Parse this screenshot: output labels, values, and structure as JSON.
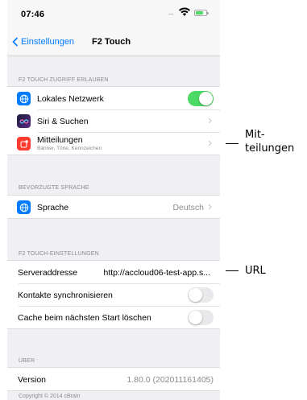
{
  "status": {
    "time": "07:46",
    "signal": "....",
    "wifi_icon": "wifi-icon",
    "battery_icon": "battery-charging-icon"
  },
  "nav": {
    "back_label": "Einstellungen",
    "title": "F2 Touch"
  },
  "sections": {
    "access": {
      "header": "F2 TOUCH ZUGRIFF ERLAUBEN",
      "local_network": {
        "label": "Lokales Netzwerk",
        "enabled": true,
        "icon": "globe-icon",
        "icon_color": "#007aff"
      },
      "siri": {
        "label": "Siri & Suchen",
        "icon": "siri-icon"
      },
      "notifications": {
        "label": "Mitteilungen",
        "sublabel": "Banner, Töne, Kennzeichen",
        "icon": "notification-icon",
        "icon_color": "#ff3b30"
      }
    },
    "language": {
      "header": "BEVORZUGTE SPRACHE",
      "language": {
        "label": "Sprache",
        "value": "Deutsch",
        "icon": "globe-icon",
        "icon_color": "#007aff"
      }
    },
    "settings": {
      "header": "F2 TOUCH-EINSTELLUNGEN",
      "server": {
        "label": "Serveraddresse",
        "value": "http://accloud06-test-app.s..."
      },
      "sync_contacts": {
        "label": "Kontakte synchronisieren",
        "enabled": false
      },
      "clear_cache": {
        "label": "Cache beim nächsten Start löschen",
        "enabled": false
      }
    },
    "about": {
      "header": "ÜBER",
      "version": {
        "label": "Version",
        "value": "1.80.0 (202011161405)"
      },
      "copyright": "Copyright © 2014 cBrain"
    }
  },
  "annotations": {
    "notifications_line1": "Mit-",
    "notifications_line2": "teilungen",
    "url": "URL"
  },
  "colors": {
    "accent": "#007aff",
    "toggle_on": "#4cd964",
    "background": "#efeff4"
  }
}
